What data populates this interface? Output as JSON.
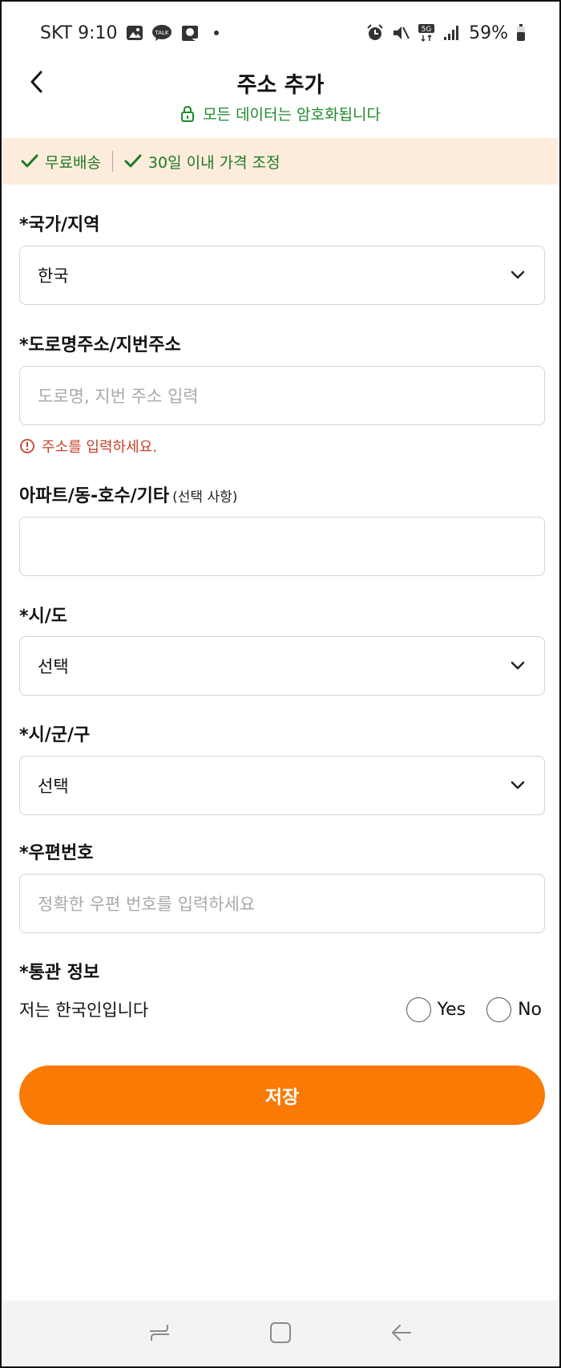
{
  "status_bar": {
    "carrier_time": "SKT 9:10",
    "battery": "59%",
    "network": "5G"
  },
  "header": {
    "title": "주소 추가",
    "secure_note": "모든 데이터는 암호화됩니다"
  },
  "promo": {
    "items": [
      "무료배송",
      "30일 이내 가격 조정"
    ]
  },
  "form": {
    "country": {
      "label": "*국가/지역",
      "value": "한국"
    },
    "address": {
      "label": "*도로명주소/지번주소",
      "placeholder": "도로명, 지번 주소 입력",
      "error": "주소를 입력하세요."
    },
    "detail": {
      "label": "아파트/동-호수/기타",
      "optional": "(선택 사항)",
      "value": ""
    },
    "province": {
      "label": "*시/도",
      "value": "선택"
    },
    "city": {
      "label": "*시/군/구",
      "value": "선택"
    },
    "postal": {
      "label": "*우편번호",
      "placeholder": "정확한 우편 번호를 입력하세요"
    },
    "customs": {
      "label": "*통관 정보",
      "question": "저는 한국인입니다",
      "options": [
        "Yes",
        "No"
      ]
    }
  },
  "save_label": "저장",
  "colors": {
    "accent": "#fa7a05",
    "success": "#1f8a2c",
    "error": "#c8412a",
    "promo_bg": "#fdecdb"
  }
}
